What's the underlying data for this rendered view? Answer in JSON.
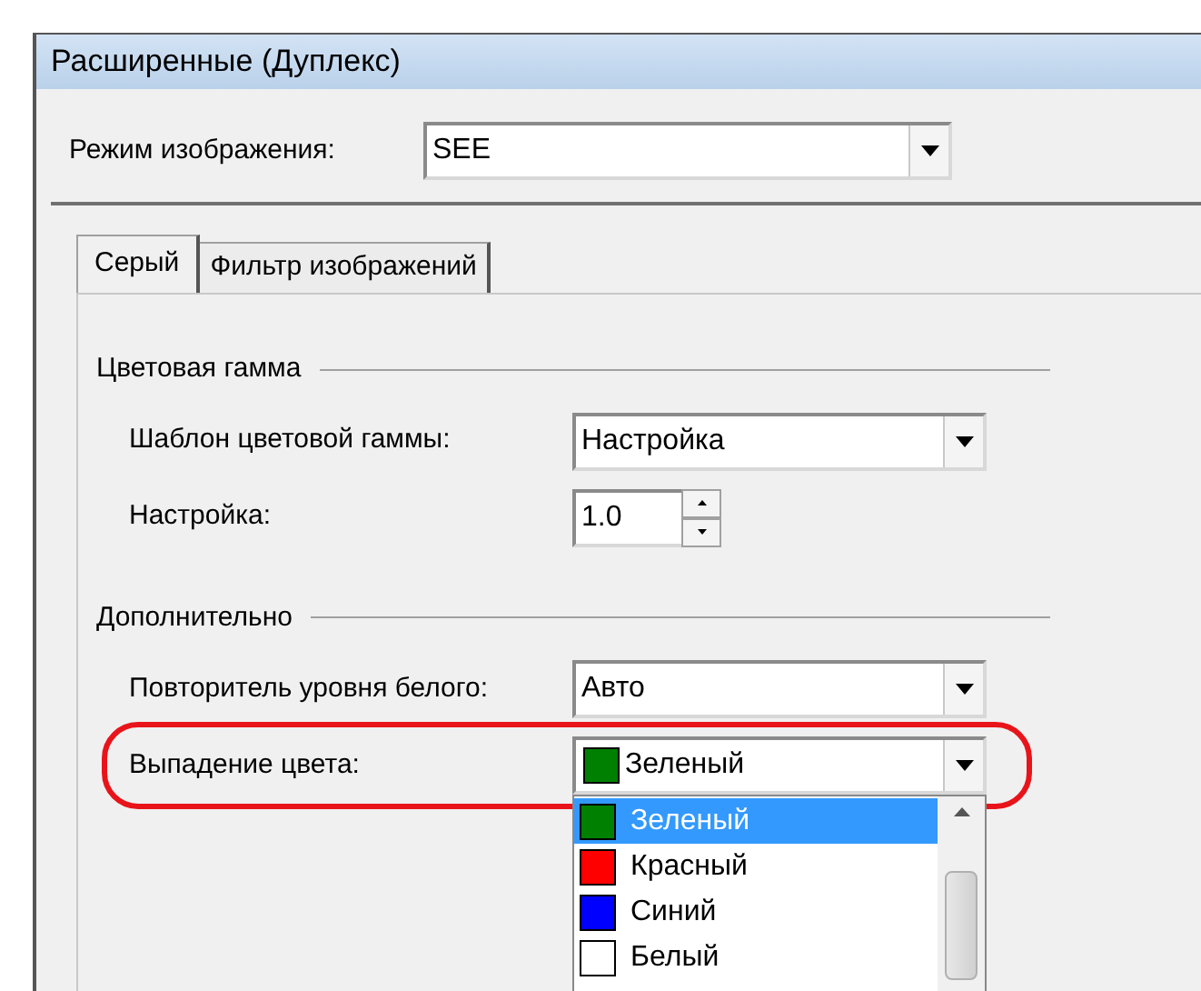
{
  "window": {
    "title": "Расширенные (Дуплекс)"
  },
  "image_mode": {
    "label": "Режим изображения:",
    "value": "SEE"
  },
  "tabs": [
    {
      "label": "Серый",
      "selected": true
    },
    {
      "label": "Фильтр изображений",
      "selected": false
    }
  ],
  "groups": [
    {
      "title": "Цветовая гамма",
      "rows": [
        {
          "kind": "combo",
          "label": "Шаблон цветовой гаммы:",
          "value": "Настройка",
          "highlighted": false
        },
        {
          "kind": "spin",
          "label": "Настройка:",
          "value": "1.0",
          "highlighted": false
        }
      ]
    },
    {
      "title": "Дополнительно",
      "rows": [
        {
          "kind": "combo",
          "label": "Повторитель уровня белого:",
          "value": "Авто",
          "highlighted": false
        },
        {
          "kind": "color",
          "label": "Выпадение цвета:",
          "value": "Зеленый",
          "color": "#008000",
          "highlighted": true,
          "expanded": true,
          "options": [
            {
              "label": "Зеленый",
              "color": "#008000",
              "selected": true
            },
            {
              "label": "Красный",
              "color": "#ff0000",
              "selected": false
            },
            {
              "label": "Синий",
              "color": "#0000ff",
              "selected": false
            },
            {
              "label": "Белый",
              "color": "#ffffff",
              "selected": false
            }
          ]
        }
      ]
    }
  ]
}
